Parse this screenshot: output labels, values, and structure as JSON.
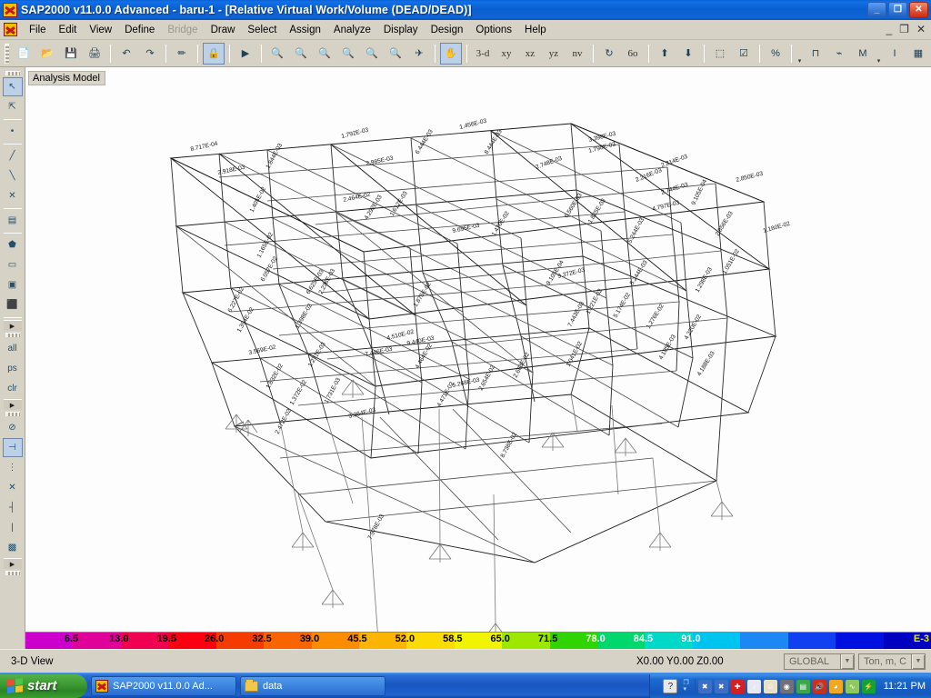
{
  "window": {
    "title": "SAP2000 v11.0.0 Advanced  - baru-1 - [Relative Virtual Work/Volume (DEAD/DEAD)]",
    "minimize_label": "_",
    "maximize_label": "❐",
    "close_label": "✕"
  },
  "mdi": {
    "minimize": "_",
    "restore": "❐",
    "close": "✕"
  },
  "menu": [
    {
      "label": "File",
      "enabled": true
    },
    {
      "label": "Edit",
      "enabled": true
    },
    {
      "label": "View",
      "enabled": true
    },
    {
      "label": "Define",
      "enabled": true
    },
    {
      "label": "Bridge",
      "enabled": false
    },
    {
      "label": "Draw",
      "enabled": true
    },
    {
      "label": "Select",
      "enabled": true
    },
    {
      "label": "Assign",
      "enabled": true
    },
    {
      "label": "Analyze",
      "enabled": true
    },
    {
      "label": "Display",
      "enabled": true
    },
    {
      "label": "Design",
      "enabled": true
    },
    {
      "label": "Options",
      "enabled": true
    },
    {
      "label": "Help",
      "enabled": true
    }
  ],
  "toolbar": {
    "buttons": [
      {
        "name": "new-model-icon",
        "glyph": "📄",
        "kind": "icon"
      },
      {
        "name": "open-file-icon",
        "glyph": "📂",
        "kind": "icon"
      },
      {
        "name": "save-icon",
        "glyph": "💾",
        "kind": "icon"
      },
      {
        "name": "print-icon",
        "glyph": "🖨",
        "kind": "icon"
      },
      {
        "name": "undo-icon",
        "glyph": "↶",
        "kind": "icon"
      },
      {
        "name": "redo-icon",
        "glyph": "↷",
        "kind": "icon"
      },
      {
        "name": "refresh-window-icon",
        "glyph": "✏",
        "kind": "icon"
      },
      {
        "name": "lock-model-icon",
        "glyph": "🔒",
        "kind": "icon",
        "active": true
      },
      {
        "name": "run-analysis-icon",
        "glyph": "▶",
        "kind": "icon"
      },
      {
        "name": "rubber-band-zoom-icon",
        "glyph": "🔍",
        "kind": "icon"
      },
      {
        "name": "restore-full-view-icon",
        "glyph": "🔍",
        "kind": "icon"
      },
      {
        "name": "previous-zoom-icon",
        "glyph": "🔍",
        "kind": "icon"
      },
      {
        "name": "zoom-in-one-step-icon",
        "glyph": "🔍",
        "kind": "icon"
      },
      {
        "name": "zoom-out-one-step-icon",
        "glyph": "🔍",
        "kind": "icon"
      },
      {
        "name": "set-default-3d-view-icon",
        "glyph": "🔍",
        "kind": "icon"
      },
      {
        "name": "perspective-toggle-icon",
        "glyph": "✈",
        "kind": "icon"
      },
      {
        "name": "pan-icon",
        "glyph": "✋",
        "kind": "icon",
        "active": true
      },
      {
        "name": "view-3d-button",
        "glyph": "3-d",
        "kind": "text"
      },
      {
        "name": "view-xy-button",
        "glyph": "xy",
        "kind": "text"
      },
      {
        "name": "view-xz-button",
        "glyph": "xz",
        "kind": "text"
      },
      {
        "name": "view-yz-button",
        "glyph": "yz",
        "kind": "text"
      },
      {
        "name": "view-nv-button",
        "glyph": "nv",
        "kind": "text"
      },
      {
        "name": "rotate-3d-view-icon",
        "glyph": "↻",
        "kind": "icon"
      },
      {
        "name": "perspective-glasses-icon",
        "glyph": "6o",
        "kind": "text"
      },
      {
        "name": "move-up-level-icon",
        "glyph": "⬆",
        "kind": "icon"
      },
      {
        "name": "move-down-level-icon",
        "glyph": "⬇",
        "kind": "icon"
      },
      {
        "name": "select-all-icon",
        "glyph": "⬚",
        "kind": "icon"
      },
      {
        "name": "assign-to-group-icon",
        "glyph": "☑",
        "kind": "icon"
      },
      {
        "name": "show-percent-icon",
        "glyph": "%",
        "kind": "icon"
      },
      {
        "name": "frame-member-force-icon",
        "glyph": "⊓",
        "kind": "icon"
      },
      {
        "name": "deformed-shape-icon",
        "glyph": "⌁",
        "kind": "icon"
      },
      {
        "name": "moment-diagram-icon",
        "glyph": "M",
        "kind": "icon"
      },
      {
        "name": "text-display-icon",
        "glyph": "I",
        "kind": "icon"
      },
      {
        "name": "contour-fill-icon",
        "glyph": "▦",
        "kind": "icon"
      }
    ]
  },
  "left_toolbar": {
    "buttons": [
      {
        "name": "pointer-select-icon",
        "glyph": "↖",
        "active": true
      },
      {
        "name": "reshape-element-icon",
        "glyph": "⇱"
      },
      {
        "name": "draw-joint-icon",
        "glyph": "•"
      },
      {
        "name": "draw-frame-cable-icon",
        "glyph": "╱"
      },
      {
        "name": "quick-draw-frame-icon",
        "glyph": "╲"
      },
      {
        "name": "quick-draw-brace-icon",
        "glyph": "✕"
      },
      {
        "name": "quick-draw-secondary-beam-icon",
        "glyph": "▤"
      },
      {
        "name": "draw-poly-area-icon",
        "glyph": "⬟"
      },
      {
        "name": "draw-rectangular-area-icon",
        "glyph": "▭"
      },
      {
        "name": "quick-draw-area-icon",
        "glyph": "▣"
      },
      {
        "name": "draw-solid-icon",
        "glyph": "⬛"
      },
      {
        "name": "select-all-label",
        "glyph": "all"
      },
      {
        "name": "get-previous-selection-label",
        "glyph": "ps"
      },
      {
        "name": "clear-selection-label",
        "glyph": "clr"
      },
      {
        "name": "deselect-lines-icon",
        "glyph": "⊘"
      },
      {
        "name": "snap-to-point-icon",
        "glyph": "⊣",
        "active": true
      },
      {
        "name": "snap-to-grid-icon",
        "glyph": "⋮"
      },
      {
        "name": "snap-to-intersection-icon",
        "glyph": "✕"
      },
      {
        "name": "snap-to-midpoint-icon",
        "glyph": "┤"
      },
      {
        "name": "snap-to-line-end-icon",
        "glyph": "|"
      },
      {
        "name": "snap-to-fine-grid-icon",
        "glyph": "▩"
      }
    ],
    "expander": "▶"
  },
  "viewport": {
    "label": "Analysis Model"
  },
  "legend": {
    "exponent": "E-3",
    "ticks": [
      "6.5",
      "13.0",
      "19.5",
      "26.0",
      "32.5",
      "39.0",
      "45.5",
      "52.0",
      "58.5",
      "65.0",
      "71.5",
      "78.0",
      "84.5",
      "91.0"
    ],
    "colors": [
      "#cc00cc",
      "#e0009a",
      "#f00050",
      "#fa0010",
      "#f43c00",
      "#f86400",
      "#fa8c00",
      "#fbb400",
      "#fcdc00",
      "#f0f400",
      "#9ce800",
      "#30d400",
      "#00d86e",
      "#00d8c8",
      "#00c4f0",
      "#1c88f4",
      "#1040f0",
      "#0010e0",
      "#0000c0"
    ]
  },
  "statusbar": {
    "view_mode": "3-D View",
    "coordinates": "X0.00  Y0.00  Z0.00",
    "coord_system": "GLOBAL",
    "units": "Ton, m, C",
    "dropdown_arrow": "▼"
  },
  "taskbar": {
    "start_label": "start",
    "items": [
      {
        "name": "taskbar-item-sap2000",
        "label": "SAP2000 v11.0.0 Ad...",
        "icon": "sap-icon"
      },
      {
        "name": "taskbar-item-data",
        "label": "data",
        "icon": "folder-icon"
      }
    ],
    "quick_launch": {
      "help_glyph": "?",
      "arrows_glyph": "▸"
    },
    "tray_icons": [
      {
        "name": "network-disconnected-icon",
        "color": "#3c6fc4",
        "glyph": "✖"
      },
      {
        "name": "network-disconnected-2-icon",
        "color": "#3c6fc4",
        "glyph": "✖"
      },
      {
        "name": "security-shield-icon",
        "color": "#d42020",
        "glyph": "✚"
      },
      {
        "name": "media-player-icon",
        "color": "#e8e8f4",
        "glyph": "♪"
      },
      {
        "name": "smiley-icon",
        "color": "#e8e0c8",
        "glyph": "☺"
      },
      {
        "name": "disc-icon",
        "color": "#707078",
        "glyph": "◉"
      },
      {
        "name": "scanner-icon",
        "color": "#3aa848",
        "glyph": "▤"
      },
      {
        "name": "volume-icon",
        "color": "#c83020",
        "glyph": "🔊"
      },
      {
        "name": "sunglasses-icon",
        "color": "#f0a820",
        "glyph": "◕"
      },
      {
        "name": "cable-icon",
        "color": "#90c860",
        "glyph": "∿"
      },
      {
        "name": "power-icon",
        "color": "#18a038",
        "glyph": "⚡"
      }
    ],
    "clock": "11:21 PM"
  },
  "chart_data": {
    "type": "heatmap",
    "title": "Relative Virtual Work/Volume (DEAD/DEAD)",
    "subtitle": "Analysis Model - 3-D View",
    "colorbar_label": "E-3",
    "colorbar_ticks": [
      6.5,
      13.0,
      19.5,
      26.0,
      32.5,
      39.0,
      45.5,
      52.0,
      58.5,
      65.0,
      71.5,
      78.0,
      84.5,
      91.0
    ],
    "colorbar_range": [
      0,
      97.5
    ],
    "value_labels": [
      "8.717E-04",
      "2.918E-03",
      "2.985E-03",
      "2.464E-02",
      "1.456E-03",
      "1.798E-03",
      "1.792E-03",
      "1.844E-03",
      "8.444E-03",
      "6.444E-03",
      "2.748E-03",
      "2.216E-03",
      "3.398E-03",
      "2.214E-03",
      "2.744E-03",
      "2.850E-03",
      "1.180E-02",
      "9.105E-04",
      "4.797E-03",
      "9.695E-03",
      "1.405E-02",
      "4.292E-03",
      "1.165E-02",
      "5.244E-03",
      "1.612E-03",
      "6.560E-03",
      "9.372E-03",
      "1.825E-03",
      "1.470E-02",
      "2.856E-03",
      "1.051E-02",
      "5.244E-03",
      "1.298E-03",
      "4.220E-02",
      "4.188E-03",
      "7.443E-03",
      "6.057E-02",
      "2.236E-03",
      "4.510E-02",
      "4.464E-02",
      "2.654E-02",
      "1.221E-02",
      "1.271E-03",
      "9.440E-03",
      "3.364E-03",
      "2.683E-02",
      "4.185E-03",
      "8.738E-02",
      "7.978E-03",
      "1.832E-02",
      "1.372E-02",
      "1.731E-03",
      "7.446E-03",
      "3.569E-02",
      "6.227E-02",
      "1.394E-02",
      "2.472E-02",
      "1.398E-02",
      "4.471E-02",
      "5.268E-03",
      "5.174E-02",
      "1.041E-02",
      "1.276E-02",
      "6.625E-03",
      "1.875E-02",
      "9.105E-04"
    ],
    "xlabel": "",
    "ylabel": "",
    "description": "3-D structural frame model colored by relative virtual work per unit volume; each member is annotated with its scalar value in scientific notation."
  }
}
